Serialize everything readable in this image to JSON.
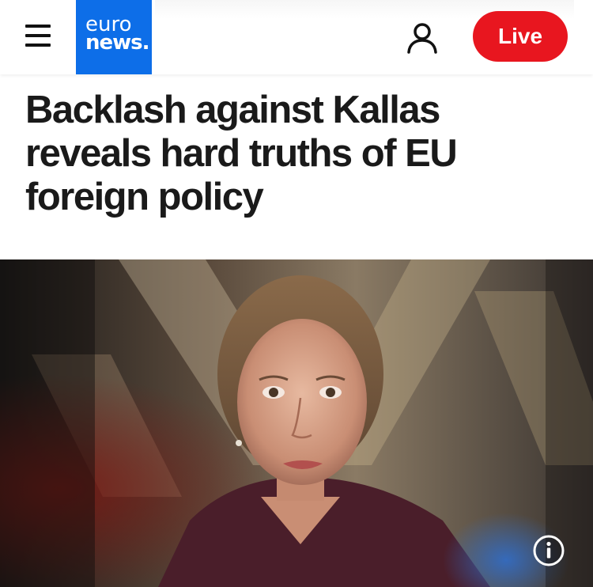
{
  "header": {
    "menu_icon": "hamburger-menu-icon",
    "logo": {
      "line1": "euro",
      "line2": "news.",
      "background": "#0d6ee8"
    },
    "user_icon": "user-account-icon",
    "live_label": "Live",
    "live_color": "#e8161f"
  },
  "article": {
    "headline": "Backlash against Kallas reveals hard truths of EU foreign policy"
  },
  "hero": {
    "info_icon": "info-circle-icon"
  }
}
